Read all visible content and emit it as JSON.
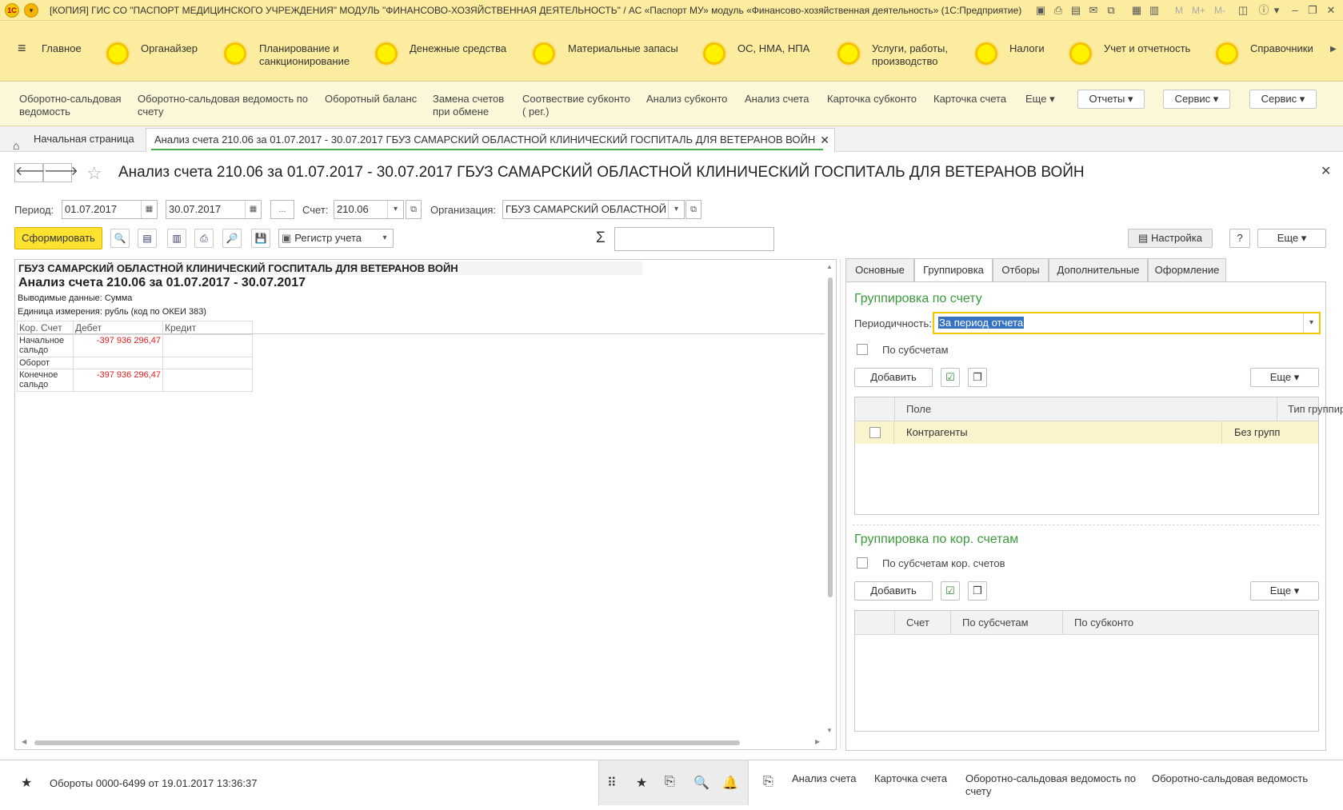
{
  "window": {
    "title": "[КОПИЯ] ГИС СО \"ПАСПОРТ МЕДИЦИНСКОГО УЧРЕЖДЕНИЯ\" МОДУЛЬ \"ФИНАНСОВО-ХОЗЯЙСТВЕННАЯ ДЕЯТЕЛЬНОСТЬ\" / АС «Паспорт МУ» модуль «Финансово-хозяйственная деятельность» (1С:Предприятие)",
    "logo_text": "1С",
    "toolbar_letters": [
      "M",
      "M+",
      "M-"
    ]
  },
  "sections": [
    {
      "label": "Главное"
    },
    {
      "label": "Органайзер"
    },
    {
      "label": "Планирование и\nсанкционирование"
    },
    {
      "label": "Денежные средства"
    },
    {
      "label": "Материальные запасы"
    },
    {
      "label": "ОС, НМА, НПА"
    },
    {
      "label": "Услуги, работы,\nпроизводство"
    },
    {
      "label": "Налоги"
    },
    {
      "label": "Учет и отчетность"
    },
    {
      "label": "Справочники"
    }
  ],
  "commands": {
    "links": [
      "Оборотно-сальдовая\nведомость",
      "Оборотно-сальдовая ведомость по\nсчету",
      "Оборотный баланс",
      "Замена счетов\nпри обмене",
      "Соотвествие субконто\n( рег.)",
      "Анализ субконто",
      "Анализ счета",
      "Карточка субконто",
      "Карточка счета",
      "Еще ▾"
    ],
    "buttons": [
      "Отчеты",
      "Сервис",
      "Сервис"
    ]
  },
  "open_tabs": {
    "home": "Начальная страница",
    "active": "Анализ счета 210.06 за 01.07.2017 - 30.07.2017 ГБУЗ САМАРСКИЙ ОБЛАСТНОЙ КЛИНИЧЕСКИЙ ГОСПИТАЛЬ ДЛЯ ВЕТЕРАНОВ ВОЙН"
  },
  "form": {
    "title": "Анализ счета 210.06 за 01.07.2017 - 30.07.2017 ГБУЗ САМАРСКИЙ ОБЛАСТНОЙ КЛИНИЧЕСКИЙ ГОСПИТАЛЬ ДЛЯ ВЕТЕРАНОВ ВОЙН",
    "period_label": "Период:",
    "date_from": "01.07.2017",
    "date_to": "30.07.2017",
    "ellipsis": "...",
    "account_label": "Счет:",
    "account_value": "210.06",
    "org_label": "Организация:",
    "org_value": "ГБУЗ САМАРСКИЙ ОБЛАСТНОЙ",
    "generate_btn": "Сформировать",
    "register_select": "Регистр учета",
    "sigma": "Σ",
    "settings_btn": "Настройка",
    "help_btn": "?",
    "more_btn": "Еще"
  },
  "report": {
    "org": "ГБУЗ САМАРСКИЙ ОБЛАСТНОЙ КЛИНИЧЕСКИЙ ГОСПИТАЛЬ ДЛЯ ВЕТЕРАНОВ ВОЙН",
    "title": "Анализ счета 210.06 за 01.07.2017 - 30.07.2017",
    "output_data": "Выводимые данные:  Сумма",
    "unit": "Единица измерения: рубль (код по ОКЕИ 383)",
    "columns": [
      "Кор. Счет",
      "Дебет",
      "Кредит"
    ],
    "rows": [
      {
        "label": "Начальное\nсальдо",
        "debit": "-397 936 296,47",
        "credit": ""
      },
      {
        "label": "Оборот",
        "debit": "",
        "credit": ""
      },
      {
        "label": "Конечное\nсальдо",
        "debit": "-397 936 296,47",
        "credit": ""
      }
    ]
  },
  "settings": {
    "tabs": [
      "Основные",
      "Группировка",
      "Отборы",
      "Дополнительные",
      "Оформление"
    ],
    "active_tab": "Группировка",
    "group_by_account_title": "Группировка по счету",
    "periodicity_label": "Периодичность:",
    "periodicity_value": "За период отчета",
    "by_subaccounts_label": "По субсчетам",
    "add_btn": "Добавить",
    "more_btn": "Еще",
    "grid1_columns": [
      "Поле",
      "Тип группир..."
    ],
    "grid1_rows": [
      {
        "field": "Контрагенты",
        "type": "Без групп"
      }
    ],
    "group_by_corr_title": "Группировка по кор. счетам",
    "by_corr_subaccounts_label": "По субсчетам кор. счетов",
    "add_btn2": "Добавить",
    "more_btn2": "Еще",
    "grid2_columns": [
      "Счет",
      "По субсчетам",
      "По субконто"
    ]
  },
  "bottom": {
    "history_item": "Обороты 0000-6499 от 19.01.2017 13:36:37",
    "links": [
      "Анализ счета",
      "Карточка счета",
      "Оборотно-сальдовая ведомость по\nсчету",
      "Оборотно-сальдовая ведомость"
    ]
  },
  "colors": {
    "section_bg": "#fbec9f",
    "accent_yellow": "#fde22f",
    "negative": "#e01b1b",
    "group_title": "#3a9a3a"
  }
}
